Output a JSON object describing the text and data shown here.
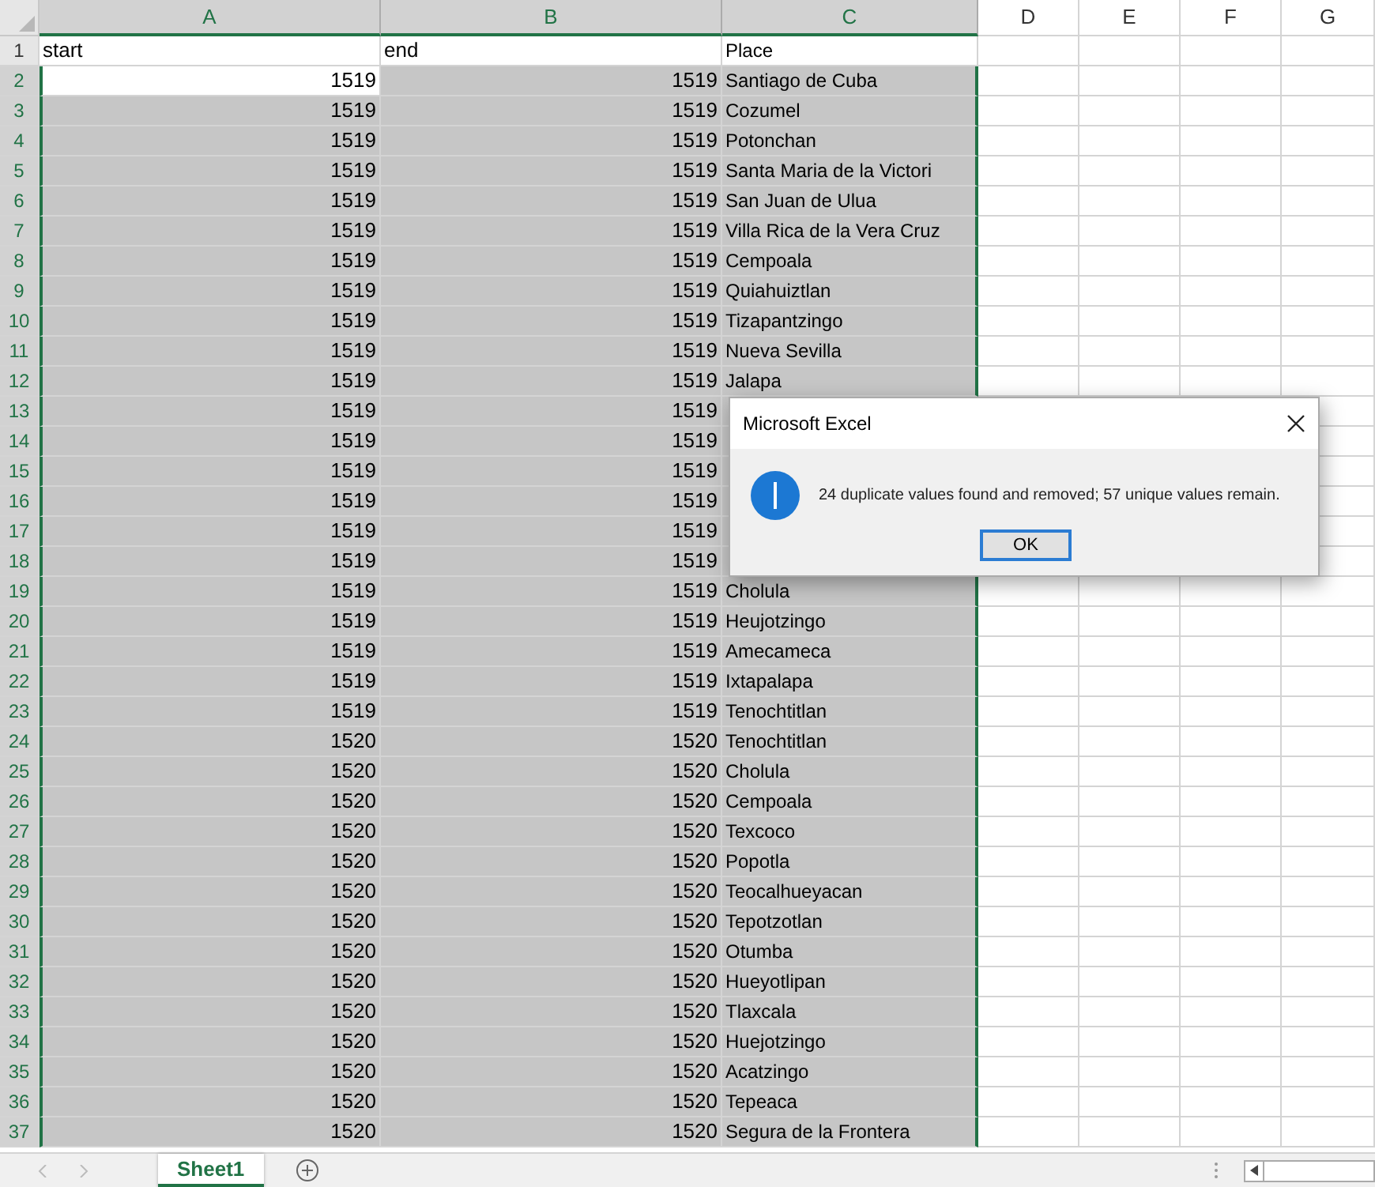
{
  "columns": [
    {
      "label": "A",
      "selected": true
    },
    {
      "label": "B",
      "selected": true
    },
    {
      "label": "C",
      "selected": true
    },
    {
      "label": "D",
      "selected": false
    },
    {
      "label": "E",
      "selected": false
    },
    {
      "label": "F",
      "selected": false
    },
    {
      "label": "G",
      "selected": false
    }
  ],
  "header_row": {
    "number": "1",
    "start": "start",
    "end": "end",
    "place": "Place"
  },
  "rows": [
    {
      "number": "2",
      "start": "1519",
      "end": "1519",
      "place": "Santiago de Cuba",
      "selected": true,
      "active": true
    },
    {
      "number": "3",
      "start": "1519",
      "end": "1519",
      "place": "Cozumel",
      "selected": true,
      "active": false
    },
    {
      "number": "4",
      "start": "1519",
      "end": "1519",
      "place": "Potonchan",
      "selected": true,
      "active": false
    },
    {
      "number": "5",
      "start": "1519",
      "end": "1519",
      "place": "Santa Maria de la Victori",
      "selected": true,
      "active": false
    },
    {
      "number": "6",
      "start": "1519",
      "end": "1519",
      "place": "San Juan de Ulua",
      "selected": true,
      "active": false
    },
    {
      "number": "7",
      "start": "1519",
      "end": "1519",
      "place": "Villa Rica de la Vera Cruz",
      "selected": true,
      "active": false
    },
    {
      "number": "8",
      "start": "1519",
      "end": "1519",
      "place": "Cempoala",
      "selected": true,
      "active": false
    },
    {
      "number": "9",
      "start": "1519",
      "end": "1519",
      "place": "Quiahuiztlan",
      "selected": true,
      "active": false
    },
    {
      "number": "10",
      "start": "1519",
      "end": "1519",
      "place": "Tizapantzingo",
      "selected": true,
      "active": false
    },
    {
      "number": "11",
      "start": "1519",
      "end": "1519",
      "place": "Nueva Sevilla",
      "selected": true,
      "active": false
    },
    {
      "number": "12",
      "start": "1519",
      "end": "1519",
      "place": "Jalapa",
      "selected": true,
      "active": false
    },
    {
      "number": "13",
      "start": "1519",
      "end": "1519",
      "selected": true,
      "active": false
    },
    {
      "number": "14",
      "start": "1519",
      "end": "1519",
      "selected": true,
      "active": false
    },
    {
      "number": "15",
      "start": "1519",
      "end": "1519",
      "selected": true,
      "active": false
    },
    {
      "number": "16",
      "start": "1519",
      "end": "1519",
      "selected": true,
      "active": false
    },
    {
      "number": "17",
      "start": "1519",
      "end": "1519",
      "selected": true,
      "active": false
    },
    {
      "number": "18",
      "start": "1519",
      "end": "1519",
      "selected": true,
      "active": false
    },
    {
      "number": "19",
      "start": "1519",
      "end": "1519",
      "place": "Cholula",
      "selected": true,
      "active": false
    },
    {
      "number": "20",
      "start": "1519",
      "end": "1519",
      "place": "Heujotzingo",
      "selected": true,
      "active": false
    },
    {
      "number": "21",
      "start": "1519",
      "end": "1519",
      "place": "Amecameca",
      "selected": true,
      "active": false
    },
    {
      "number": "22",
      "start": "1519",
      "end": "1519",
      "place": "Ixtapalapa",
      "selected": true,
      "active": false
    },
    {
      "number": "23",
      "start": "1519",
      "end": "1519",
      "place": "Tenochtitlan",
      "selected": true,
      "active": false
    },
    {
      "number": "24",
      "start": "1520",
      "end": "1520",
      "place": "Tenochtitlan",
      "selected": true,
      "active": false
    },
    {
      "number": "25",
      "start": "1520",
      "end": "1520",
      "place": "Cholula",
      "selected": true,
      "active": false
    },
    {
      "number": "26",
      "start": "1520",
      "end": "1520",
      "place": "Cempoala",
      "selected": true,
      "active": false
    },
    {
      "number": "27",
      "start": "1520",
      "end": "1520",
      "place": "Texcoco",
      "selected": true,
      "active": false
    },
    {
      "number": "28",
      "start": "1520",
      "end": "1520",
      "place": "Popotla",
      "selected": true,
      "active": false
    },
    {
      "number": "29",
      "start": "1520",
      "end": "1520",
      "place": "Teocalhueyacan",
      "selected": true,
      "active": false
    },
    {
      "number": "30",
      "start": "1520",
      "end": "1520",
      "place": "Tepotzotlan",
      "selected": true,
      "active": false
    },
    {
      "number": "31",
      "start": "1520",
      "end": "1520",
      "place": "Otumba",
      "selected": true,
      "active": false
    },
    {
      "number": "32",
      "start": "1520",
      "end": "1520",
      "place": "Hueyotlipan",
      "selected": true,
      "active": false
    },
    {
      "number": "33",
      "start": "1520",
      "end": "1520",
      "place": "Tlaxcala",
      "selected": true,
      "active": false
    },
    {
      "number": "34",
      "start": "1520",
      "end": "1520",
      "place": "Huejotzingo",
      "selected": true,
      "active": false
    },
    {
      "number": "35",
      "start": "1520",
      "end": "1520",
      "place": "Acatzingo",
      "selected": true,
      "active": false
    },
    {
      "number": "36",
      "start": "1520",
      "end": "1520",
      "place": "Tepeaca",
      "selected": true,
      "active": false
    },
    {
      "number": "37",
      "start": "1520",
      "end": "1520",
      "place": "Segura de la Frontera",
      "selected": true,
      "active": false
    }
  ],
  "dialog": {
    "title": "Microsoft Excel",
    "message": "24 duplicate values found and removed; 57 unique values remain.",
    "button": "OK"
  },
  "sheet_tabs": [
    {
      "label": "Sheet1",
      "selected": true
    }
  ]
}
